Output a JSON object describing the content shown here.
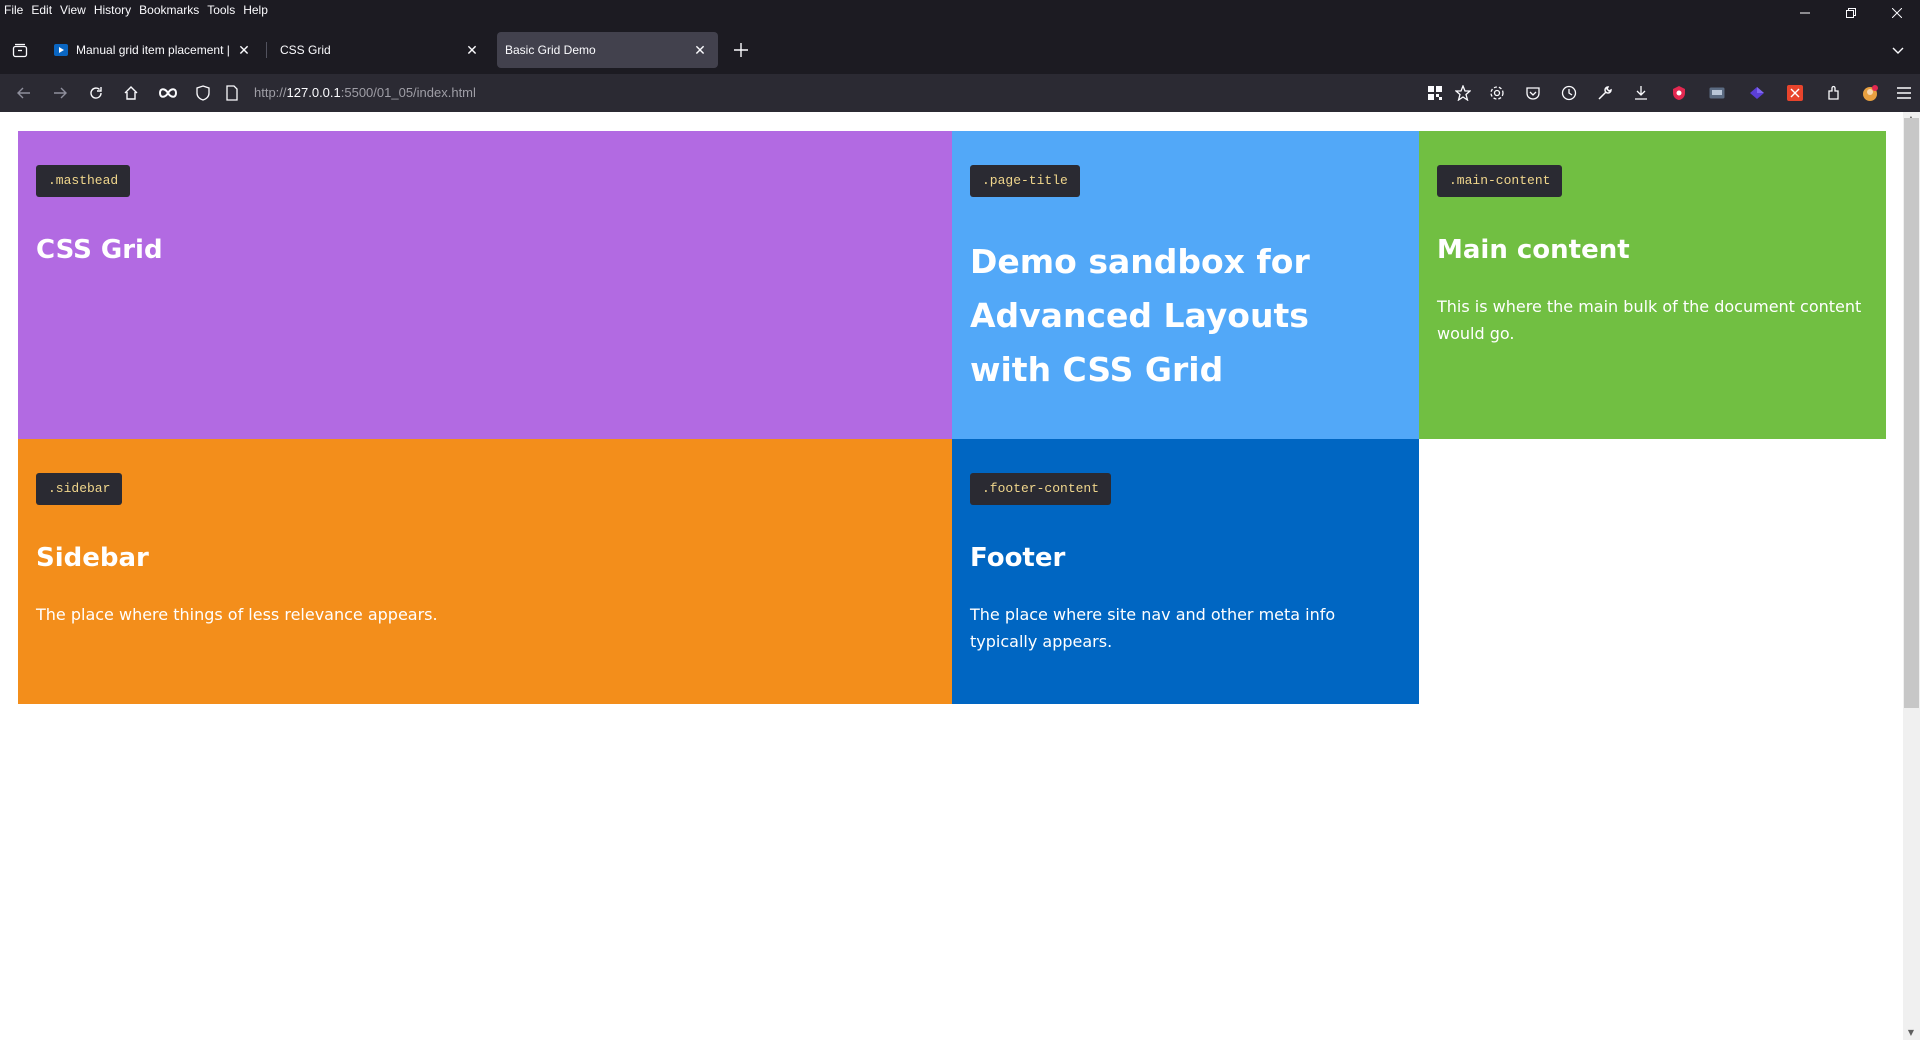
{
  "menubar": {
    "items": [
      "File",
      "Edit",
      "View",
      "History",
      "Bookmarks",
      "Tools",
      "Help"
    ]
  },
  "tabs": [
    {
      "label": "Manual grid item placement | L",
      "active": false
    },
    {
      "label": "CSS Grid",
      "active": false
    },
    {
      "label": "Basic Grid Demo",
      "active": true
    }
  ],
  "urlbar": {
    "scheme": "http://",
    "host": "127.0.0.1",
    "rest": ":5500/01_05/index.html"
  },
  "page": {
    "masthead": {
      "tag": ".masthead",
      "heading": "CSS Grid",
      "color": "#b26ae2"
    },
    "page_title": {
      "tag": ".page-title",
      "heading": "Demo sandbox for Advanced Layouts with CSS Grid",
      "color": "#52a8f8"
    },
    "main_content": {
      "tag": ".main-content",
      "heading": "Main content",
      "text": "This is where the main bulk of the document content would go.",
      "color": "#71bf42"
    },
    "sidebar": {
      "tag": ".sidebar",
      "heading": "Sidebar",
      "text": "The place where things of less relevance appears.",
      "color": "#f38e1b"
    },
    "footer": {
      "tag": ".footer-content",
      "heading": "Footer",
      "text": "The place where site nav and other meta info typically appears.",
      "color": "#0066c2"
    }
  },
  "icons": {
    "back": "arrow-left-icon",
    "forward": "arrow-right-icon",
    "reload": "reload-icon",
    "home": "home-icon"
  }
}
